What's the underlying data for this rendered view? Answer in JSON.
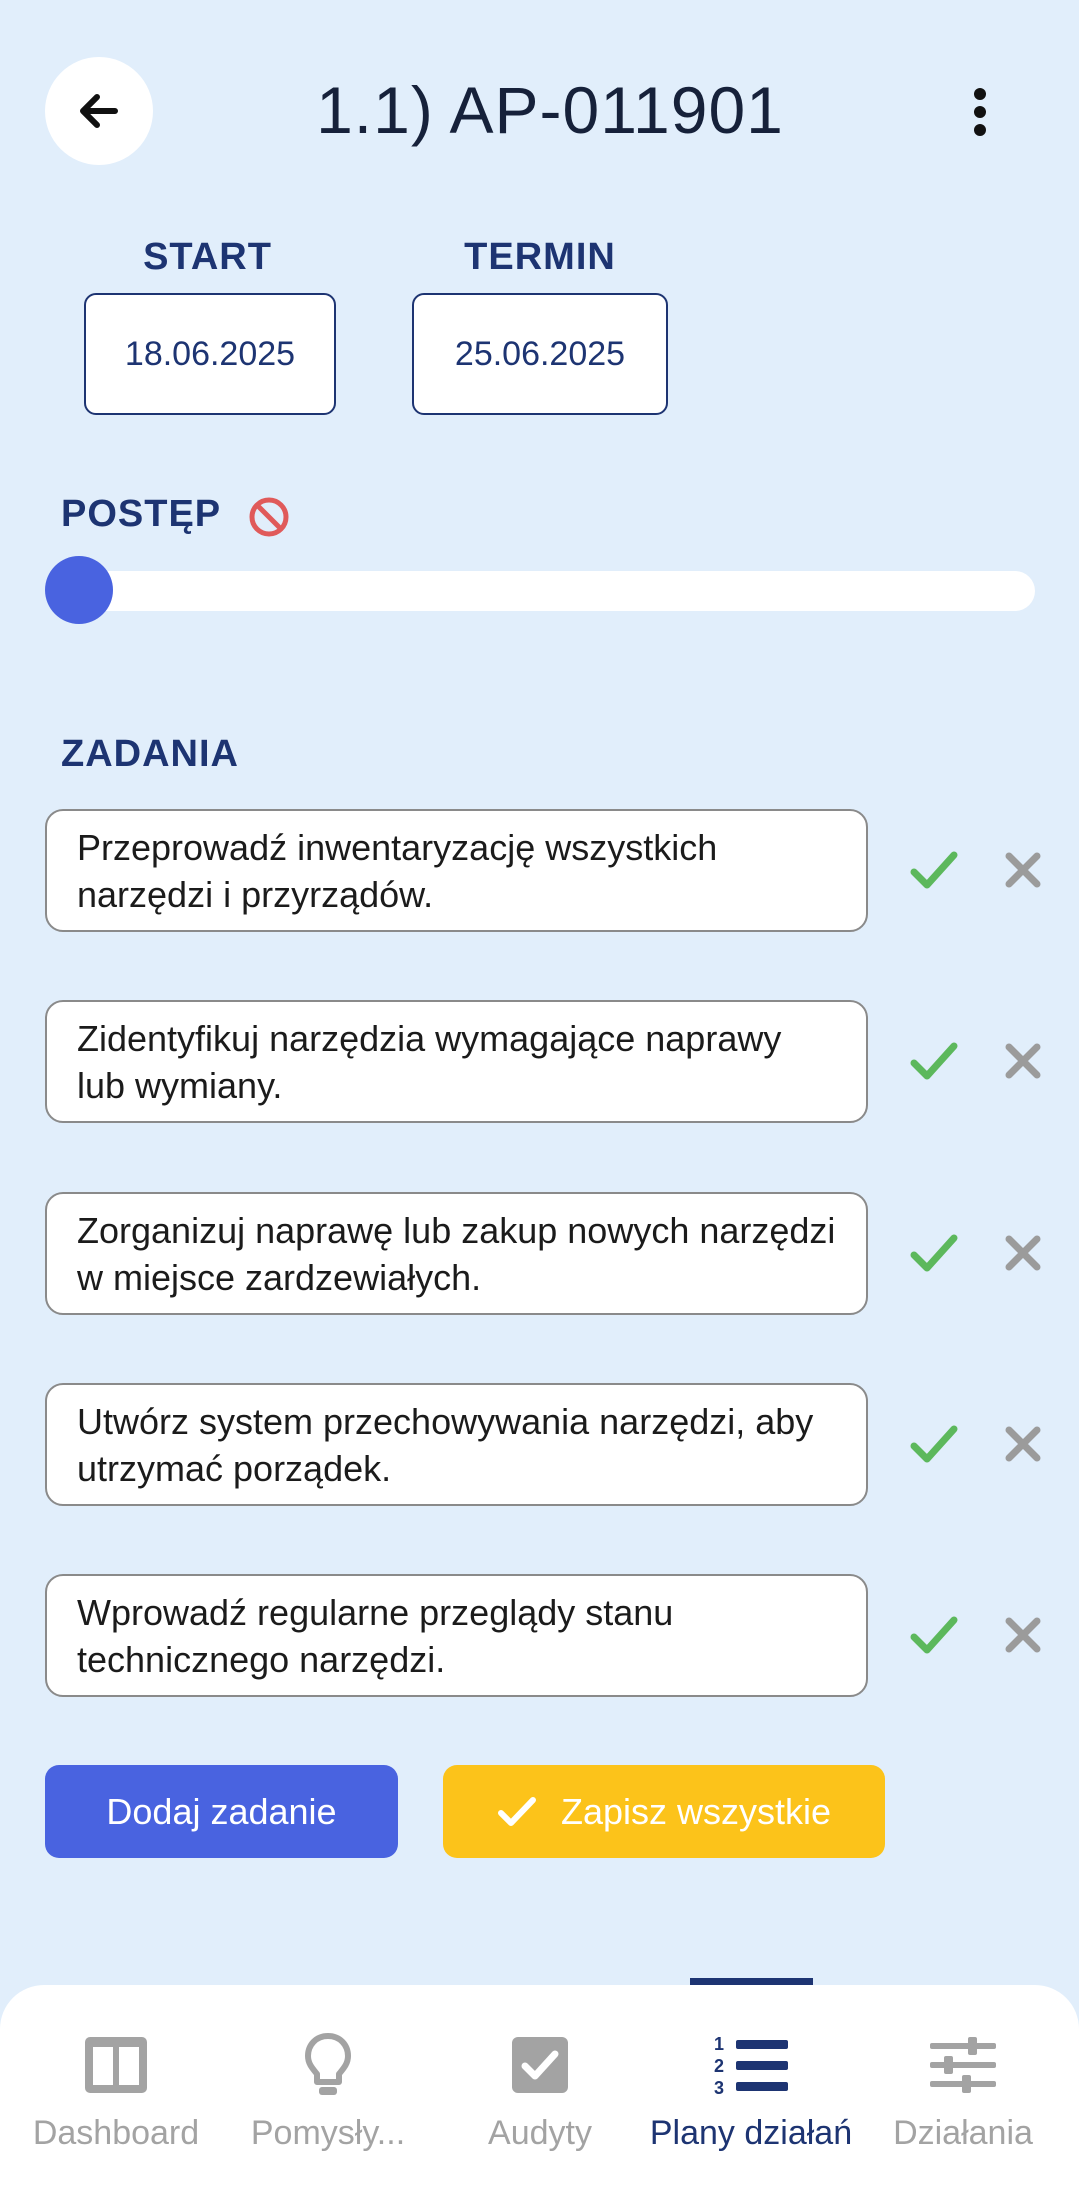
{
  "header": {
    "title": "1.1) AP-011901"
  },
  "dates": {
    "start_label": "START",
    "start_value": "18.06.2025",
    "deadline_label": "TERMIN",
    "deadline_value": "25.06.2025"
  },
  "progress": {
    "label": "POSTĘP",
    "percent": 0
  },
  "tasks": {
    "label": "ZADANIA",
    "items": [
      {
        "text": "Przeprowadź inwentaryzację wszystkich narzędzi i przyrządów."
      },
      {
        "text": "Zidentyfikuj narzędzia wymagające naprawy lub wymiany."
      },
      {
        "text": "Zorganizuj naprawę lub zakup nowych narzędzi w miejsce zardzewiałych."
      },
      {
        "text": "Utwórz system przechowywania narzędzi, aby utrzymać porządek."
      },
      {
        "text": "Wprowadź regularne przeglądy stanu technicznego narzędzi."
      }
    ]
  },
  "actions": {
    "add_task": "Dodaj zadanie",
    "save_all": "Zapisz wszystkie"
  },
  "bottom_nav": {
    "items": [
      {
        "label": "Dashboard",
        "icon": "dashboard-icon"
      },
      {
        "label": "Pomysły...",
        "icon": "lightbulb-icon"
      },
      {
        "label": "Audyty",
        "icon": "checkbox-icon"
      },
      {
        "label": "Plany działań",
        "icon": "numbered-list-icon",
        "active": true
      },
      {
        "label": "Działania",
        "icon": "sliders-icon"
      }
    ]
  },
  "colors": {
    "background": "#e1eefb",
    "navy": "#1d3472",
    "primary": "#4963e0",
    "accent_yellow": "#fcc31a",
    "check_green": "#5cb85c",
    "delete_gray": "#9b9b9b",
    "blocked_red": "#e05a5a"
  }
}
